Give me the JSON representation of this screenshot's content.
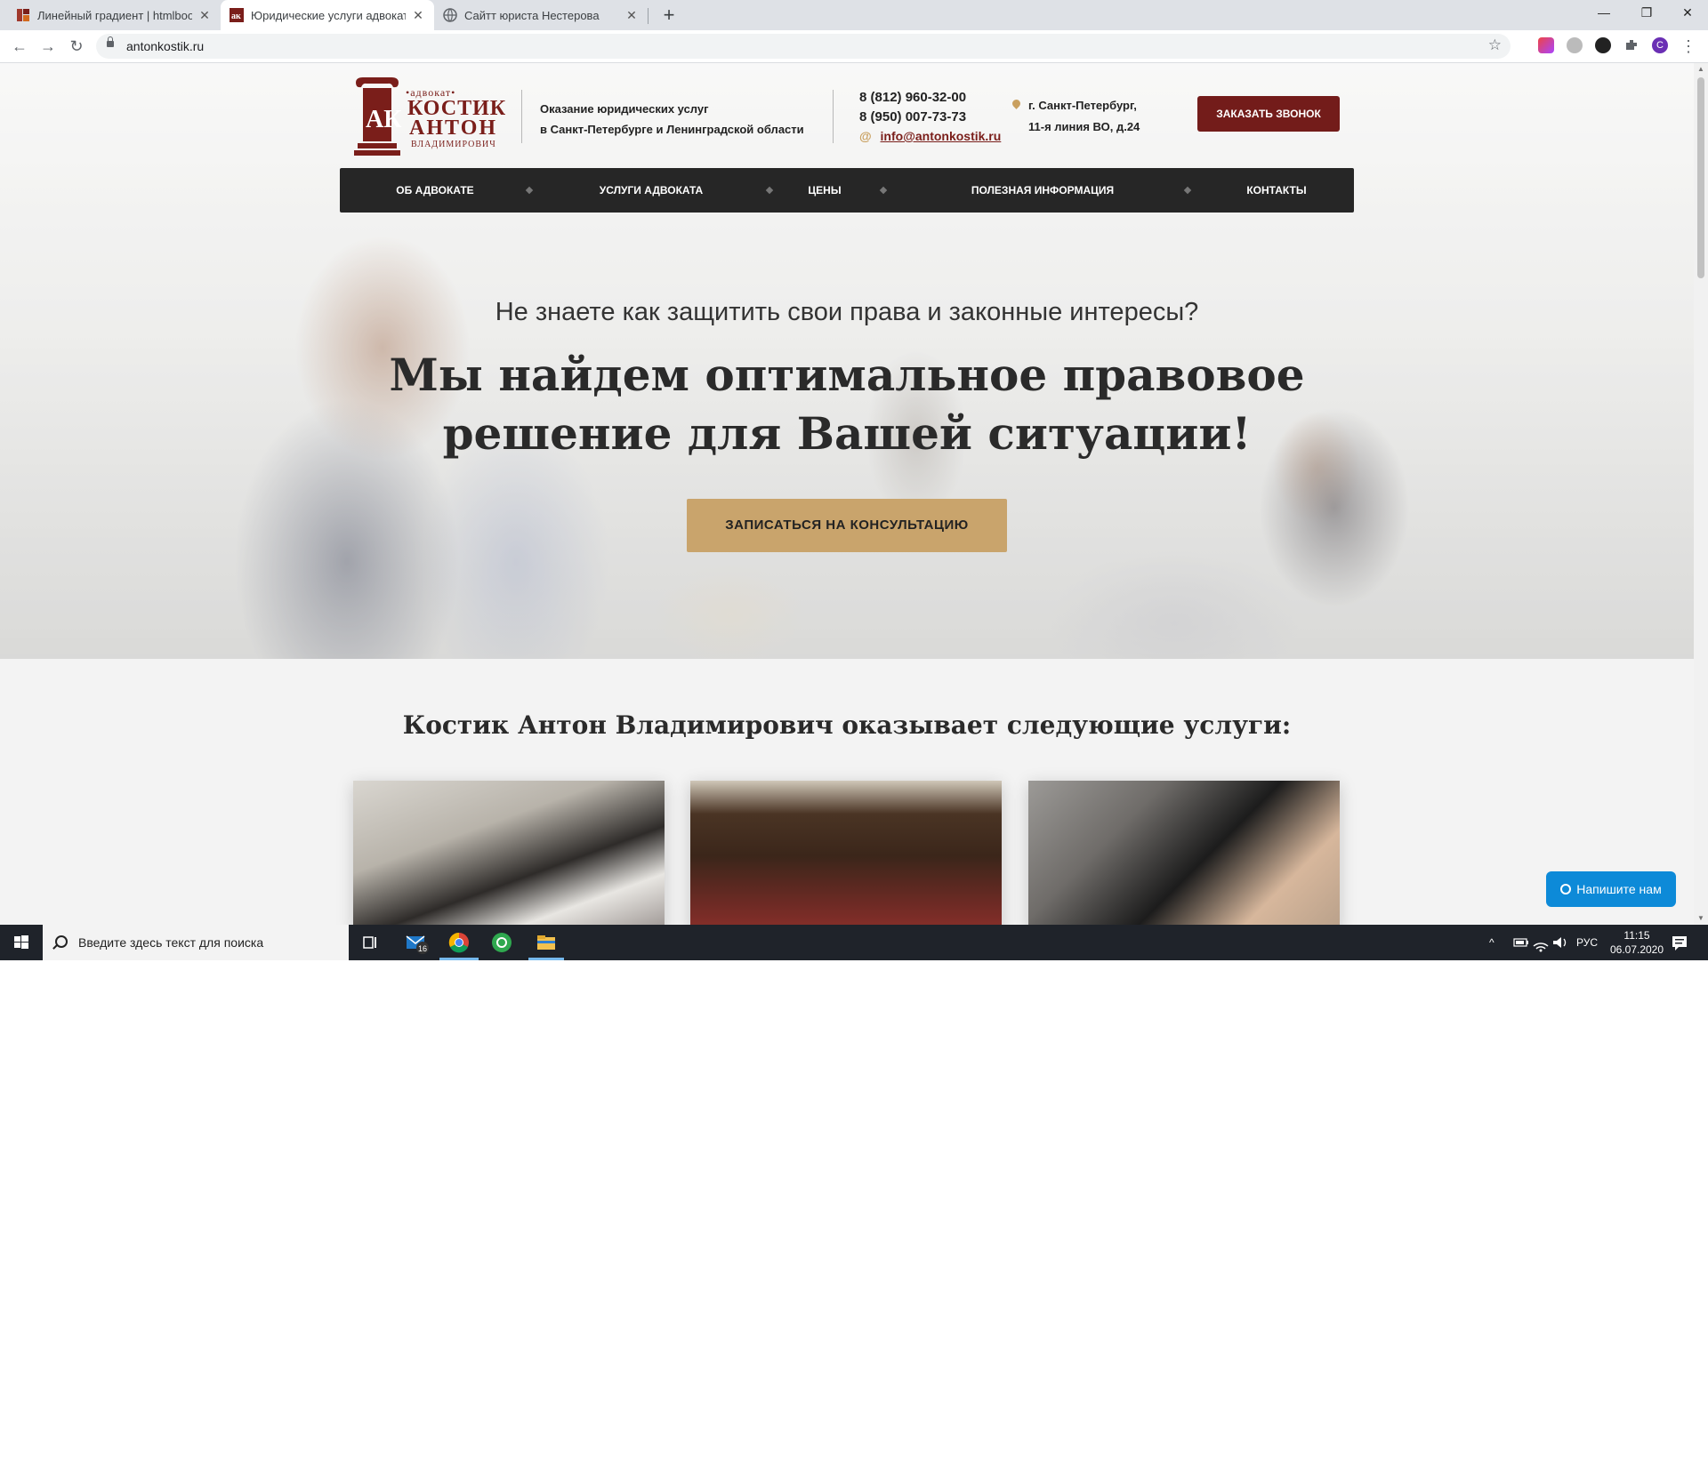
{
  "browser": {
    "tabs": [
      {
        "title": "Линейный градиент | htmlbook",
        "close": "✕"
      },
      {
        "title": "Юридические услуги адвоката | ",
        "close": "✕"
      },
      {
        "title": "Сайтт юриста Нестерова",
        "close": "✕"
      }
    ],
    "new_tab": "+",
    "window": {
      "minimize": "—",
      "restore": "❐",
      "close": "✕"
    },
    "nav": {
      "back": "←",
      "forward": "→",
      "reload": "↻"
    },
    "url": "antonkostik.ru",
    "bookmark": "☆",
    "profile_initial": "C",
    "menu": "⋮"
  },
  "header": {
    "logo": {
      "small": "•адвокат•",
      "line1": "КОСТИК",
      "line2": "АНТОН",
      "line3": "ВЛАДИМИРОВИЧ",
      "monogram": "АК"
    },
    "tagline_line1": "Оказание юридических услуг",
    "tagline_line2": "в Санкт-Петербурге и Ленинградской области",
    "phone1": "8 (812) 960-32-00",
    "phone2": "8 (950) 007-73-73",
    "email": "info@antonkostik.ru",
    "email_icon": "@",
    "address_line1": "г. Санкт-Петербург,",
    "address_line2": "11-я линия ВО, д.24",
    "callback_button": "ЗАКАЗАТЬ ЗВОНОК"
  },
  "nav": [
    "ОБ АДВОКАТЕ",
    "УСЛУГИ АДВОКАТА",
    "ЦЕНЫ",
    "ПОЛЕЗНАЯ ИНФОРМАЦИЯ",
    "КОНТАКТЫ"
  ],
  "hero": {
    "subtitle": "Не знаете как защитить свои права и законные интересы?",
    "title_line1": "Мы найдем оптимальное правовое",
    "title_line2": "решение для Вашей ситуации!",
    "button": "ЗАПИСАТЬСЯ НА КОНСУЛЬТАЦИЮ"
  },
  "services": {
    "heading": "Костик Антон Владимирович оказывает следующие услуги:"
  },
  "chat": {
    "label": "Напишите нам"
  },
  "taskbar": {
    "search_placeholder": "Введите здесь текст для поиска",
    "mail_badge": "16",
    "language": "РУС",
    "time": "11:15",
    "date": "06.07.2020",
    "tray_up": "^"
  }
}
